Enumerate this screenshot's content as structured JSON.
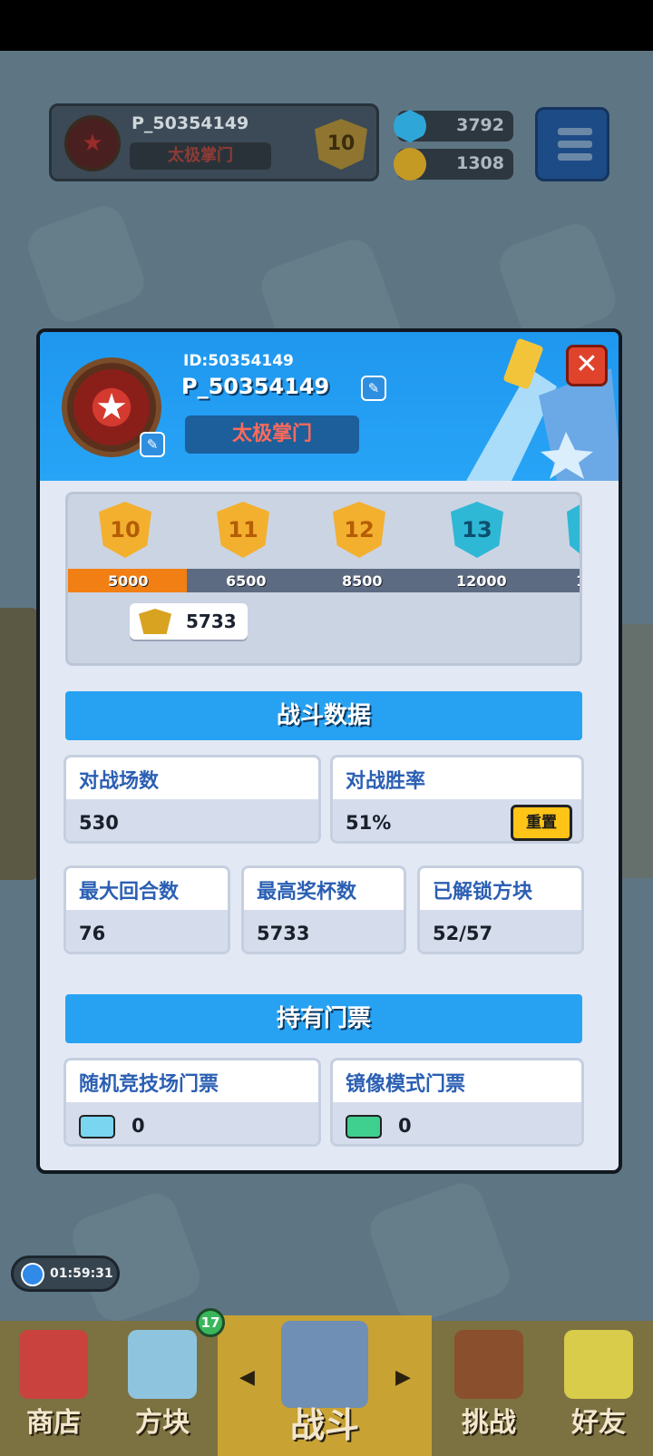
{
  "header": {
    "player_name": "P_50354149",
    "clan": "太极掌门",
    "rank_level": "10",
    "gems": "3792",
    "coins": "1308"
  },
  "profile": {
    "id_label": "ID:50354149",
    "name": "P_50354149",
    "clan": "太极掌门",
    "close_icon": "✕"
  },
  "rank_track": {
    "levels": [
      "10",
      "11",
      "12",
      "13"
    ],
    "thresholds": [
      "5000",
      "6500",
      "8500",
      "12000",
      "1"
    ],
    "progress": 0.23,
    "current_trophies": "5733"
  },
  "battle_stats": {
    "title": "战斗数据",
    "matches_label": "对战场数",
    "matches_value": "530",
    "winrate_label": "对战胜率",
    "winrate_value": "51%",
    "reset_label": "重置",
    "max_rounds_label": "最大回合数",
    "max_rounds_value": "76",
    "max_trophies_label": "最高奖杯数",
    "max_trophies_value": "5733",
    "unlocked_label": "已解锁方块",
    "unlocked_value": "52/57"
  },
  "tickets": {
    "title": "持有门票",
    "random_label": "随机竞技场门票",
    "random_value": "0",
    "mirror_label": "镜像模式门票",
    "mirror_value": "0"
  },
  "bottom_nav": {
    "timer": "01:59:31",
    "shop": "商店",
    "blocks": "方块",
    "blocks_badge": "17",
    "battle": "战斗",
    "challenge": "挑战",
    "friends": "好友"
  },
  "colors": {
    "accent_blue": "#27a2f3",
    "progress_orange": "#f27f13",
    "close_red": "#e0432c",
    "reset_yellow": "#ffc417"
  }
}
